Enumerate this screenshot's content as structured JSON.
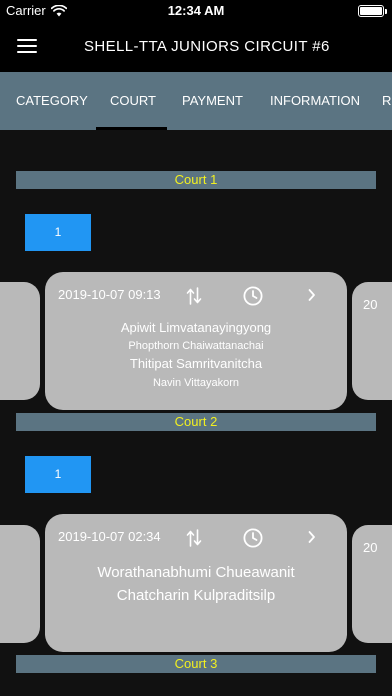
{
  "status_bar": {
    "carrier": "Carrier",
    "time": "12:34 AM",
    "icons": [
      "wifi-icon",
      "battery-icon"
    ],
    "battery_level": 1.0
  },
  "nav": {
    "title": "SHELL-TTA JUNIORS CIRCUIT #6",
    "menu_icon": "hamburger-icon"
  },
  "tabs": [
    {
      "label": "CATEGORY"
    },
    {
      "label": "COURT",
      "selected": true
    },
    {
      "label": "PAYMENT"
    },
    {
      "label": "INFORMATION"
    },
    {
      "label": "RE"
    }
  ],
  "courts": [
    {
      "label": "Court 1"
    },
    {
      "label": "Court 2"
    },
    {
      "label": "Court 3"
    }
  ],
  "rounds": [
    {
      "label": "1"
    },
    {
      "label": "1"
    }
  ],
  "matches": [
    {
      "datetime": "2019-10-07 09:13",
      "players": [
        "Apiwit Limvatanayingyong",
        "Phopthorn Chaiwattanachai",
        "Thitipat Samritvanitcha",
        "Navin Vittayakorn"
      ],
      "next_card_partial": "20"
    },
    {
      "datetime": "2019-10-07 02:34",
      "players": [
        "Worathanabhumi Chueawanit",
        "Chatcharin Kulpraditsilp"
      ],
      "next_card_partial": "20"
    }
  ],
  "colors": {
    "accent_blue": "#2196f3",
    "court_label_yellow": "#f2f020",
    "tab_bar": "#5b7482",
    "card": "#b9b9b9"
  }
}
